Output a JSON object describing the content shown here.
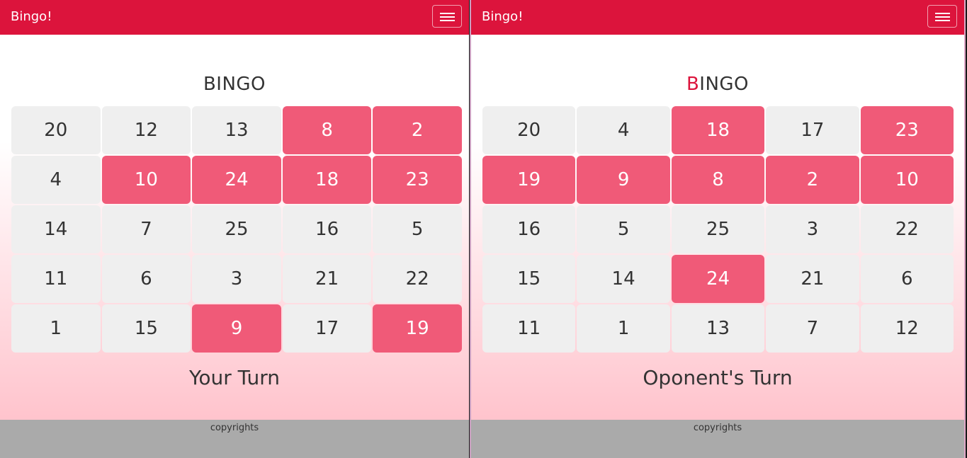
{
  "left": {
    "brand": "Bingo!",
    "title": "BINGO",
    "board": [
      {
        "n": "20",
        "m": false
      },
      {
        "n": "12",
        "m": false
      },
      {
        "n": "13",
        "m": false
      },
      {
        "n": "8",
        "m": true
      },
      {
        "n": "2",
        "m": true
      },
      {
        "n": "4",
        "m": false
      },
      {
        "n": "10",
        "m": true
      },
      {
        "n": "24",
        "m": true
      },
      {
        "n": "18",
        "m": true
      },
      {
        "n": "23",
        "m": true
      },
      {
        "n": "14",
        "m": false
      },
      {
        "n": "7",
        "m": false
      },
      {
        "n": "25",
        "m": false
      },
      {
        "n": "16",
        "m": false
      },
      {
        "n": "5",
        "m": false
      },
      {
        "n": "11",
        "m": false
      },
      {
        "n": "6",
        "m": false
      },
      {
        "n": "3",
        "m": false
      },
      {
        "n": "21",
        "m": false
      },
      {
        "n": "22",
        "m": false
      },
      {
        "n": "1",
        "m": false
      },
      {
        "n": "15",
        "m": false
      },
      {
        "n": "9",
        "m": true
      },
      {
        "n": "17",
        "m": false
      },
      {
        "n": "19",
        "m": true
      }
    ],
    "turn": "Your Turn",
    "footer": "copyrights"
  },
  "right": {
    "brand": "Bingo!",
    "title_accent": "B",
    "title_rest": "INGO",
    "board": [
      {
        "n": "20",
        "m": false
      },
      {
        "n": "4",
        "m": false
      },
      {
        "n": "18",
        "m": true
      },
      {
        "n": "17",
        "m": false
      },
      {
        "n": "23",
        "m": true
      },
      {
        "n": "19",
        "m": true
      },
      {
        "n": "9",
        "m": true
      },
      {
        "n": "8",
        "m": true
      },
      {
        "n": "2",
        "m": true
      },
      {
        "n": "10",
        "m": true
      },
      {
        "n": "16",
        "m": false
      },
      {
        "n": "5",
        "m": false
      },
      {
        "n": "25",
        "m": false
      },
      {
        "n": "3",
        "m": false
      },
      {
        "n": "22",
        "m": false
      },
      {
        "n": "15",
        "m": false
      },
      {
        "n": "14",
        "m": false
      },
      {
        "n": "24",
        "m": true
      },
      {
        "n": "21",
        "m": false
      },
      {
        "n": "6",
        "m": false
      },
      {
        "n": "11",
        "m": false
      },
      {
        "n": "1",
        "m": false
      },
      {
        "n": "13",
        "m": false
      },
      {
        "n": "7",
        "m": false
      },
      {
        "n": "12",
        "m": false
      }
    ],
    "turn": "Oponent's Turn",
    "footer": "copyrights"
  },
  "colors": {
    "navbar": "#dc143c",
    "marked_cell": "#f05a78",
    "unmarked_cell": "#efefef",
    "footer": "#aaaaaa",
    "title_accent": "#dc143c"
  },
  "icons": {
    "menu": "hamburger-menu-icon"
  }
}
